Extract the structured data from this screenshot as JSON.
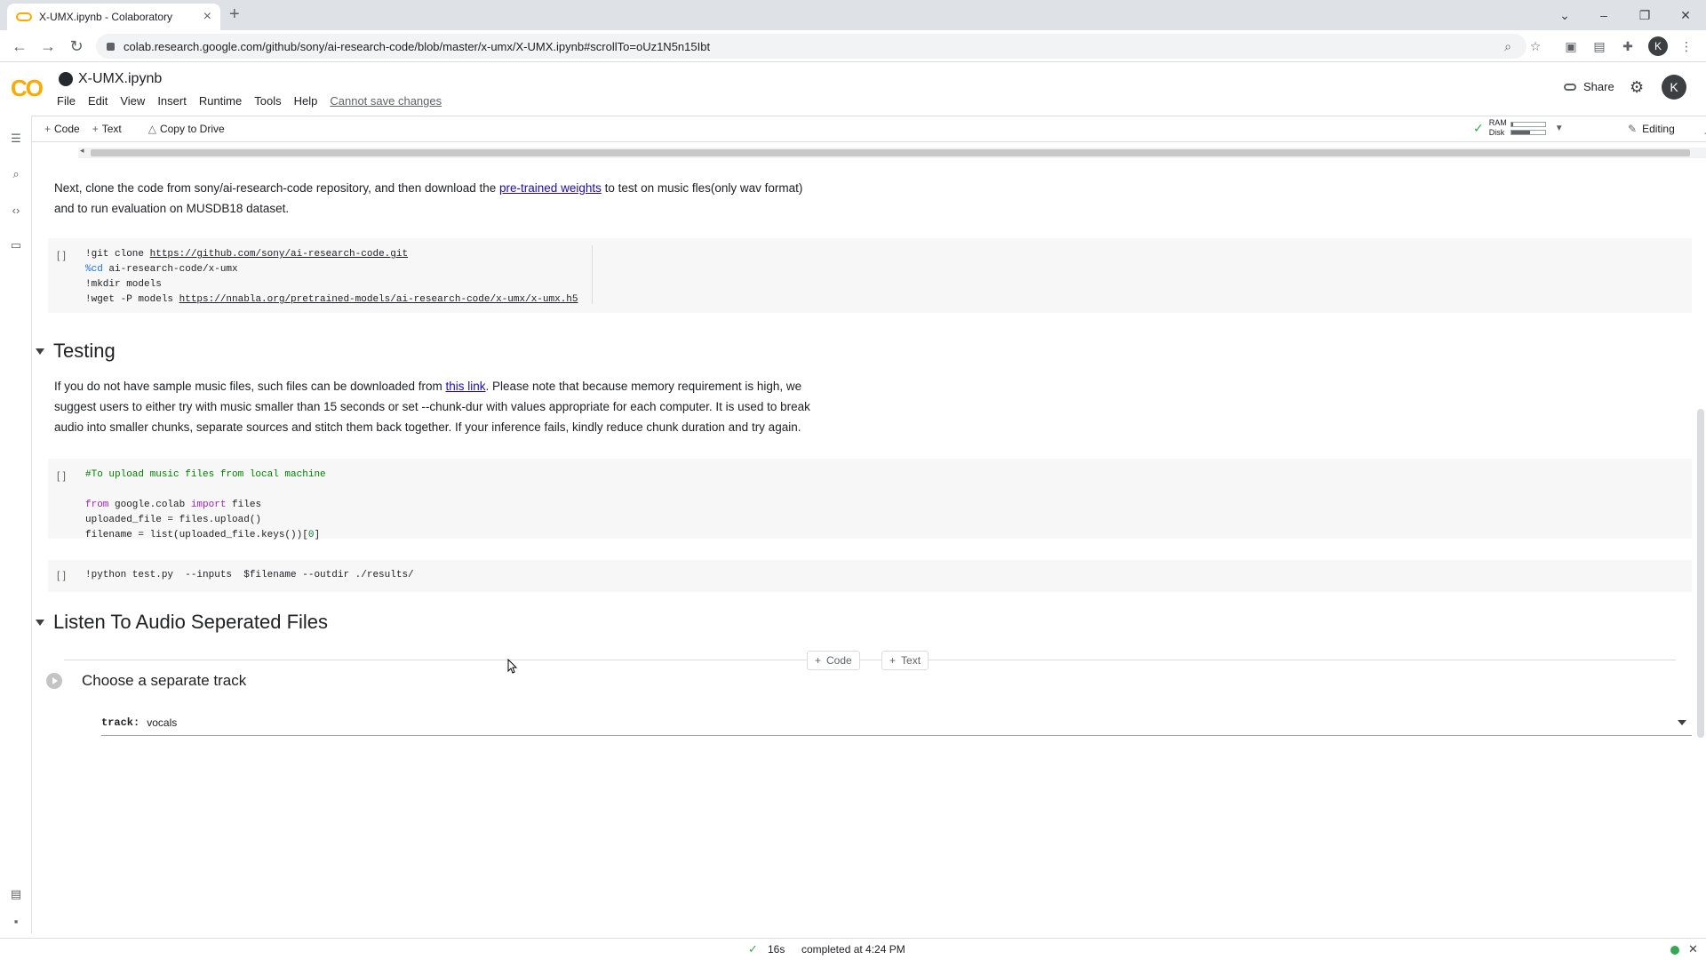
{
  "browser": {
    "tab_title": "X-UMX.ipynb - Colaboratory",
    "new_tab": "+",
    "url": "colab.research.google.com/github/sony/ai-research-code/blob/master/x-umx/X-UMX.ipynb#scrollTo=oUz1N5n15Ibt",
    "profile_initial": "K"
  },
  "colab": {
    "logo": "CO",
    "notebook_name": "X-UMX.ipynb",
    "menu": [
      "File",
      "Edit",
      "View",
      "Insert",
      "Runtime",
      "Tools",
      "Help"
    ],
    "cannot_save": "Cannot save changes",
    "share": "Share",
    "profile_initial": "K"
  },
  "toolbar": {
    "code": "Code",
    "text": "Text",
    "copy_to_drive": "Copy to Drive",
    "ram": "RAM",
    "disk": "Disk",
    "ram_usage": 0.05,
    "disk_usage": 0.55,
    "editing": "Editing"
  },
  "cells": {
    "clone_text_1": "Next, clone the code from sony/ai-research-code repository, and then download the ",
    "clone_link": "pre-trained weights",
    "clone_text_2": " to test on music fles(only wav format)",
    "clone_text_3": "and to run evaluation on MUSDB18 dataset.",
    "bracket": "[ ]",
    "code1": {
      "l1a": "!git clone ",
      "l1b": "https://github.com/sony/ai-research-code.git",
      "l2a": "%cd",
      "l2b": " ai-research-code/x-umx",
      "l3": "!mkdir models",
      "l4a": "!wget -P models ",
      "l4b": "https://nnabla.org/pretrained-models/ai-research-code/x-umx/x-umx.h5"
    },
    "testing_heading": "Testing",
    "testing_text_1a": "If you do not have sample music files, such files can be downloaded from ",
    "testing_link": "this link",
    "testing_text_1b": ". Please note that because memory requirement is high, we",
    "testing_text_2": "suggest users to either try with music smaller than 15 seconds or set --chunk-dur with values appropriate for each computer. It is used to break",
    "testing_text_3": "audio into smaller chunks, separate sources and stitch them back together. If your inference fails, kindly reduce chunk duration and try again.",
    "code2": {
      "l1": "#To upload music files from local machine",
      "l3a": "from",
      "l3b": " google.colab ",
      "l3c": "import",
      "l3d": " files",
      "l4": "uploaded_file = files.upload()",
      "l5a": "filename = list(uploaded_file.keys())[",
      "l5b": "0",
      "l5c": "]"
    },
    "code3": "!python test.py  --inputs  $filename --outdir ./results/",
    "listen_heading": "Listen To Audio Seperated Files",
    "insert_code": "Code",
    "insert_text": "Text",
    "form_title": "Choose a separate track",
    "field_label": "track:",
    "field_value": "vocals"
  },
  "status": {
    "duration": "16s",
    "completed": "completed at 4:24 PM"
  }
}
